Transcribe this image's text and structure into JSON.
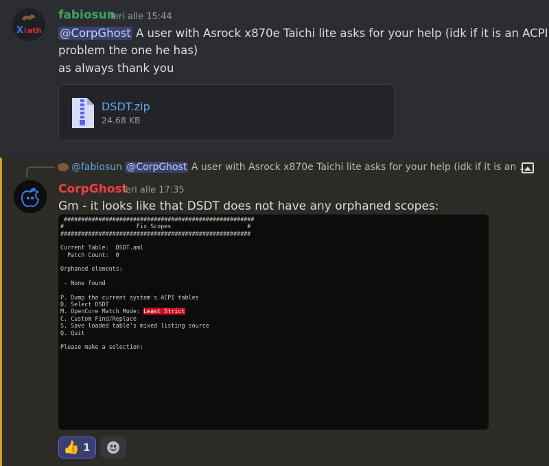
{
  "message1": {
    "username": "fabiosun",
    "username_color": "#3ba55c",
    "timestamp": "Ieri alle 15:44",
    "mention": "@CorpGhost",
    "line1_rest": " A user with Asrock x870e Taichi lite asks for your help (idk if it is an ACPI",
    "line2": "problem the one he has)",
    "line3": "as always thank you",
    "avatar_text": "Xiath",
    "attachment": {
      "filename": "DSDT.zip",
      "size": "24.68 KB",
      "icon": "zip-file-icon"
    }
  },
  "message2": {
    "reply": {
      "username": "@fabiosun",
      "mention": "@CorpGhost",
      "preview": " A user with Asrock x870e Taichi lite asks for your help (idk if it is an ...",
      "attachment_icon": "image-icon"
    },
    "username": "CorpGhost",
    "username_color": "#ed4245",
    "timestamp": "Ieri alle 17:35",
    "text": "Gm - it looks like that DSDT does not have any orphaned scopes:",
    "terminal": {
      "line01": " #######################################################",
      "line02": "#                     Fix Scopes                      #",
      "line03": "#######################################################",
      "line04": "",
      "line05": "Current Table:  DSDT.aml",
      "line06": "  Patch Count:  0",
      "line07": "",
      "line08": "Orphaned elements:",
      "line09": "",
      "line10": " - None found",
      "line11": "",
      "line12": "P. Dump the current system's ACPI tables",
      "line13": "D. Select DSDT",
      "line14_prefix": "M. OpenCore Match Mode: ",
      "line14_highlight": "Least Strict",
      "line15": "C. Custom Find/Replace",
      "line16": "S. Save loaded table's mixed listing source",
      "line17": "Q. Quit",
      "line18": "",
      "line19": "Please make a selection:"
    },
    "reactions": [
      {
        "emoji": "👍",
        "count": "1",
        "active": true
      }
    ],
    "add_reaction_icon": "add-reaction-icon"
  }
}
